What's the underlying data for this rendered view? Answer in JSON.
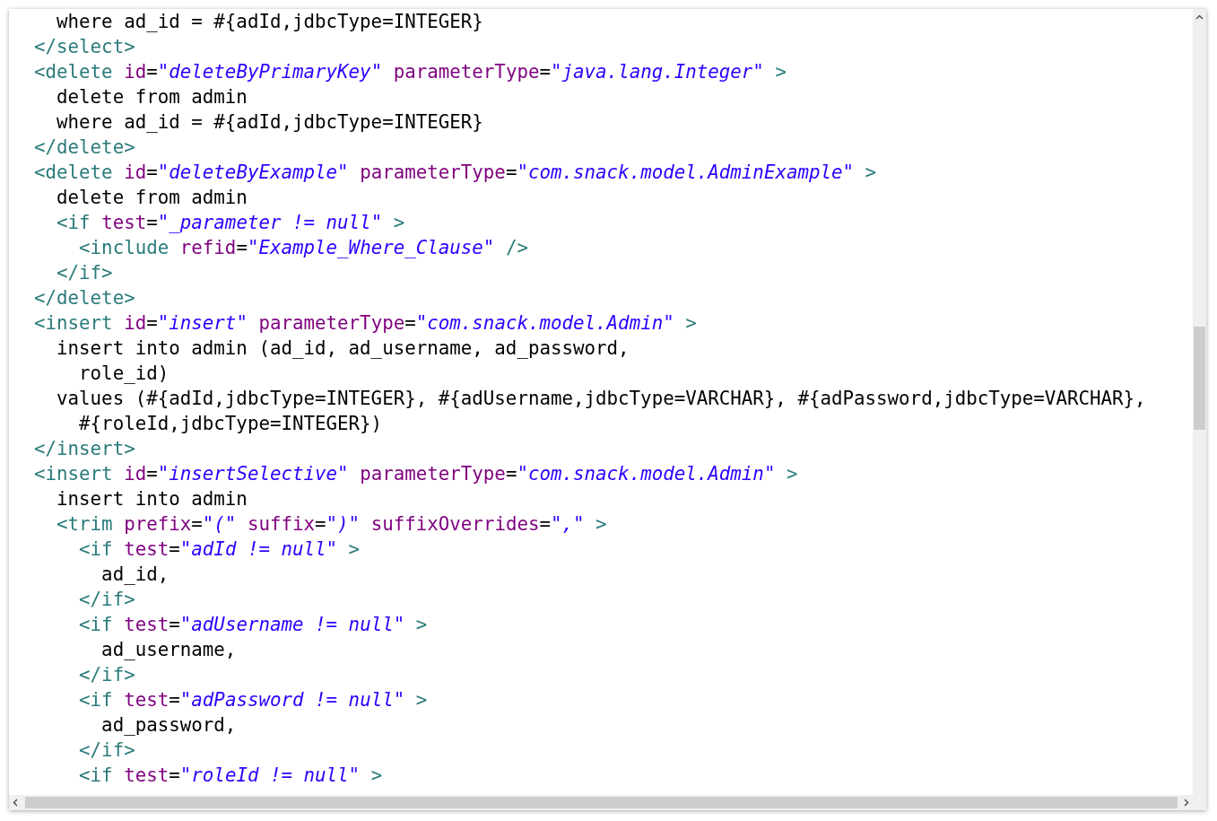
{
  "code_lines": [
    {
      "tokens": [
        {
          "kind": "plain",
          "text": "  where ad_id = #{adId,jdbcType=INTEGER}"
        }
      ]
    },
    {
      "tokens": [
        {
          "kind": "tag",
          "text": "</select>"
        }
      ]
    },
    {
      "tokens": [
        {
          "kind": "tag",
          "text": "<delete "
        },
        {
          "kind": "attr",
          "text": "id"
        },
        {
          "kind": "plain",
          "text": "="
        },
        {
          "kind": "value",
          "text": "\"deleteByPrimaryKey\" "
        },
        {
          "kind": "attr",
          "text": "parameterType"
        },
        {
          "kind": "plain",
          "text": "="
        },
        {
          "kind": "value",
          "text": "\"java.lang.Integer\" "
        },
        {
          "kind": "tag",
          "text": ">"
        }
      ]
    },
    {
      "tokens": [
        {
          "kind": "plain",
          "text": "  delete from admin"
        }
      ]
    },
    {
      "tokens": [
        {
          "kind": "plain",
          "text": "  where ad_id = #{adId,jdbcType=INTEGER}"
        }
      ]
    },
    {
      "tokens": [
        {
          "kind": "tag",
          "text": "</delete>"
        }
      ]
    },
    {
      "tokens": [
        {
          "kind": "tag",
          "text": "<delete "
        },
        {
          "kind": "attr",
          "text": "id"
        },
        {
          "kind": "plain",
          "text": "="
        },
        {
          "kind": "value",
          "text": "\"deleteByExample\" "
        },
        {
          "kind": "attr",
          "text": "parameterType"
        },
        {
          "kind": "plain",
          "text": "="
        },
        {
          "kind": "value",
          "text": "\"com.snack.model.AdminExample\" "
        },
        {
          "kind": "tag",
          "text": ">"
        }
      ]
    },
    {
      "tokens": [
        {
          "kind": "plain",
          "text": "  delete from admin"
        }
      ]
    },
    {
      "tokens": [
        {
          "kind": "tag",
          "text": "  <if "
        },
        {
          "kind": "attr",
          "text": "test"
        },
        {
          "kind": "plain",
          "text": "="
        },
        {
          "kind": "value",
          "text": "\"_parameter != null\" "
        },
        {
          "kind": "tag",
          "text": ">"
        }
      ]
    },
    {
      "tokens": [
        {
          "kind": "tag",
          "text": "    <include "
        },
        {
          "kind": "attr",
          "text": "refid"
        },
        {
          "kind": "plain",
          "text": "="
        },
        {
          "kind": "value",
          "text": "\"Example_Where_Clause\" "
        },
        {
          "kind": "tag",
          "text": "/>"
        }
      ]
    },
    {
      "tokens": [
        {
          "kind": "tag",
          "text": "  </if>"
        }
      ]
    },
    {
      "tokens": [
        {
          "kind": "tag",
          "text": "</delete>"
        }
      ]
    },
    {
      "tokens": [
        {
          "kind": "tag",
          "text": "<insert "
        },
        {
          "kind": "attr",
          "text": "id"
        },
        {
          "kind": "plain",
          "text": "="
        },
        {
          "kind": "value",
          "text": "\"insert\" "
        },
        {
          "kind": "attr",
          "text": "parameterType"
        },
        {
          "kind": "plain",
          "text": "="
        },
        {
          "kind": "value",
          "text": "\"com.snack.model.Admin\" "
        },
        {
          "kind": "tag",
          "text": ">"
        }
      ]
    },
    {
      "tokens": [
        {
          "kind": "plain",
          "text": "  insert into admin (ad_id, ad_username, ad_password,"
        }
      ]
    },
    {
      "tokens": [
        {
          "kind": "plain",
          "text": "    role_id)"
        }
      ]
    },
    {
      "tokens": [
        {
          "kind": "plain",
          "text": "  values (#{adId,jdbcType=INTEGER}, #{adUsername,jdbcType=VARCHAR}, #{adPassword,jdbcType=VARCHAR},"
        }
      ]
    },
    {
      "tokens": [
        {
          "kind": "plain",
          "text": "    #{roleId,jdbcType=INTEGER})"
        }
      ]
    },
    {
      "tokens": [
        {
          "kind": "tag",
          "text": "</insert>"
        }
      ]
    },
    {
      "tokens": [
        {
          "kind": "tag",
          "text": "<insert "
        },
        {
          "kind": "attr",
          "text": "id"
        },
        {
          "kind": "plain",
          "text": "="
        },
        {
          "kind": "value",
          "text": "\"insertSelective\" "
        },
        {
          "kind": "attr",
          "text": "parameterType"
        },
        {
          "kind": "plain",
          "text": "="
        },
        {
          "kind": "value",
          "text": "\"com.snack.model.Admin\" "
        },
        {
          "kind": "tag",
          "text": ">"
        }
      ]
    },
    {
      "tokens": [
        {
          "kind": "plain",
          "text": "  insert into admin"
        }
      ]
    },
    {
      "tokens": [
        {
          "kind": "tag",
          "text": "  <trim "
        },
        {
          "kind": "attr",
          "text": "prefix"
        },
        {
          "kind": "plain",
          "text": "="
        },
        {
          "kind": "value",
          "text": "\"(\" "
        },
        {
          "kind": "attr",
          "text": "suffix"
        },
        {
          "kind": "plain",
          "text": "="
        },
        {
          "kind": "value",
          "text": "\")\" "
        },
        {
          "kind": "attr",
          "text": "suffixOverrides"
        },
        {
          "kind": "plain",
          "text": "="
        },
        {
          "kind": "value",
          "text": "\",\" "
        },
        {
          "kind": "tag",
          "text": ">"
        }
      ]
    },
    {
      "tokens": [
        {
          "kind": "tag",
          "text": "    <if "
        },
        {
          "kind": "attr",
          "text": "test"
        },
        {
          "kind": "plain",
          "text": "="
        },
        {
          "kind": "value",
          "text": "\"adId != null\" "
        },
        {
          "kind": "tag",
          "text": ">"
        }
      ]
    },
    {
      "tokens": [
        {
          "kind": "plain",
          "text": "      ad_id,"
        }
      ]
    },
    {
      "tokens": [
        {
          "kind": "tag",
          "text": "    </if>"
        }
      ]
    },
    {
      "tokens": [
        {
          "kind": "tag",
          "text": "    <if "
        },
        {
          "kind": "attr",
          "text": "test"
        },
        {
          "kind": "plain",
          "text": "="
        },
        {
          "kind": "value",
          "text": "\"adUsername != null\" "
        },
        {
          "kind": "tag",
          "text": ">"
        }
      ]
    },
    {
      "tokens": [
        {
          "kind": "plain",
          "text": "      ad_username,"
        }
      ]
    },
    {
      "tokens": [
        {
          "kind": "tag",
          "text": "    </if>"
        }
      ]
    },
    {
      "tokens": [
        {
          "kind": "tag",
          "text": "    <if "
        },
        {
          "kind": "attr",
          "text": "test"
        },
        {
          "kind": "plain",
          "text": "="
        },
        {
          "kind": "value",
          "text": "\"adPassword != null\" "
        },
        {
          "kind": "tag",
          "text": ">"
        }
      ]
    },
    {
      "tokens": [
        {
          "kind": "plain",
          "text": "      ad_password,"
        }
      ]
    },
    {
      "tokens": [
        {
          "kind": "tag",
          "text": "    </if>"
        }
      ]
    },
    {
      "tokens": [
        {
          "kind": "tag",
          "text": "    <if "
        },
        {
          "kind": "attr",
          "text": "test"
        },
        {
          "kind": "plain",
          "text": "="
        },
        {
          "kind": "value",
          "text": "\"roleId != null\" "
        },
        {
          "kind": "tag",
          "text": ">"
        }
      ]
    }
  ]
}
